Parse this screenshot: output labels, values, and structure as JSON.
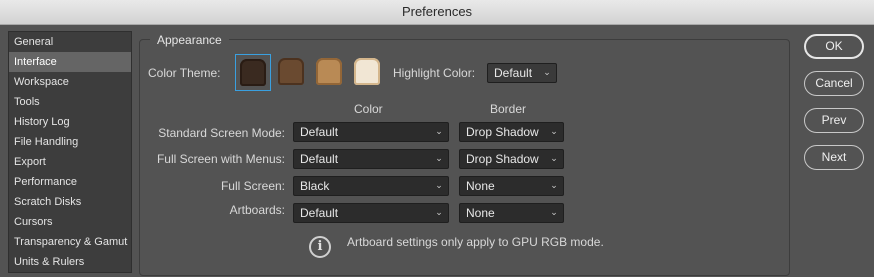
{
  "window": {
    "title": "Preferences"
  },
  "sidebar": {
    "items": [
      {
        "label": "General"
      },
      {
        "label": "Interface"
      },
      {
        "label": "Workspace"
      },
      {
        "label": "Tools"
      },
      {
        "label": "History Log"
      },
      {
        "label": "File Handling"
      },
      {
        "label": "Export"
      },
      {
        "label": "Performance"
      },
      {
        "label": "Scratch Disks"
      },
      {
        "label": "Cursors"
      },
      {
        "label": "Transparency & Gamut"
      },
      {
        "label": "Units & Rulers"
      }
    ],
    "selected": "Interface"
  },
  "appearance": {
    "legend": "Appearance",
    "color_theme_label": "Color Theme:",
    "theme_colors": [
      "#3a2a20",
      "#6a4a30",
      "#b98a55",
      "#f1e6d4"
    ],
    "selected_theme_index": 0,
    "highlight_label": "Highlight Color:",
    "highlight_value": "Default",
    "col_color": "Color",
    "col_border": "Border",
    "rows": [
      {
        "label": "Standard Screen Mode:",
        "color": "Default",
        "border": "Drop Shadow"
      },
      {
        "label": "Full Screen with Menus:",
        "color": "Default",
        "border": "Drop Shadow"
      },
      {
        "label": "Full Screen:",
        "color": "Black",
        "border": "None"
      },
      {
        "label": "Artboards:",
        "color": "Default",
        "border": "None"
      }
    ],
    "info_text": "Artboard settings only apply to GPU RGB mode."
  },
  "buttons": {
    "ok": "OK",
    "cancel": "Cancel",
    "prev": "Prev",
    "next": "Next"
  },
  "accent": "#3aa0e0"
}
